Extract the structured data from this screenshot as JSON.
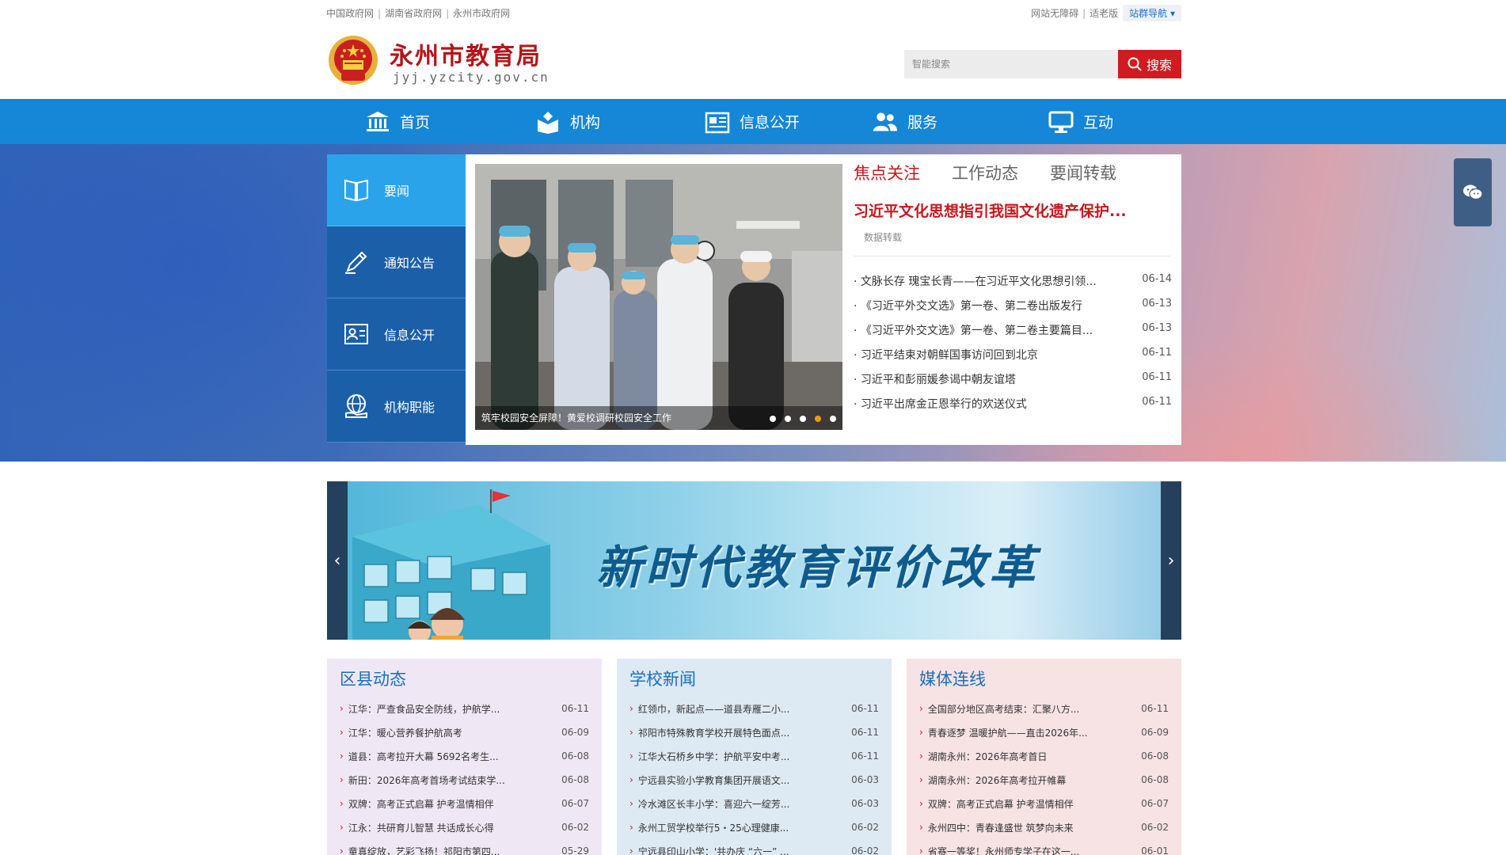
{
  "topbar": {
    "links": [
      "中国政府网",
      "湖南省政府网",
      "永州市政府网"
    ],
    "right_links": [
      "网站无障碍",
      "适老版"
    ],
    "sitemap": "站群导航 ▾"
  },
  "header": {
    "site_name": "永州市教育局",
    "site_url": "jyj.yzcity.gov.cn",
    "search_placeholder": "智能搜索",
    "search_button": "搜索"
  },
  "nav": [
    {
      "label": "首页",
      "icon": "home-icon"
    },
    {
      "label": "机构",
      "icon": "organization-icon"
    },
    {
      "label": "信息公开",
      "icon": "info-icon"
    },
    {
      "label": "服务",
      "icon": "people-icon"
    },
    {
      "label": "互动",
      "icon": "monitor-icon"
    }
  ],
  "side_menu": [
    {
      "label": "要闻",
      "icon": "book-icon"
    },
    {
      "label": "通知公告",
      "icon": "pen-icon"
    },
    {
      "label": "信息公开",
      "icon": "id-card-icon"
    },
    {
      "label": "机构职能",
      "icon": "globe-hand-icon"
    }
  ],
  "slide": {
    "caption": "筑牢校园安全屏障！黄爱校调研校园安全工作",
    "dot_count": 5,
    "active_dot": 3
  },
  "tabs": [
    "焦点关注",
    "工作动态",
    "要闻转载"
  ],
  "headline": {
    "title": "习近平文化思想指引我国文化遗产保护...",
    "source": "数据转载"
  },
  "news": [
    {
      "title": "· 文脉长存 瑰宝长青——在习近平文化思想引领...",
      "date": "06-14"
    },
    {
      "title": "· 《习近平外交文选》第一卷、第二卷出版发行",
      "date": "06-13"
    },
    {
      "title": "· 《习近平外交文选》第一卷、第二卷主要篇目...",
      "date": "06-13"
    },
    {
      "title": "· 习近平结束对朝鲜国事访问回到北京",
      "date": "06-11"
    },
    {
      "title": "· 习近平和彭丽媛参谒中朝友谊塔",
      "date": "06-11"
    },
    {
      "title": "· 习近平出席金正恩举行的欢送仪式",
      "date": "06-11"
    }
  ],
  "banner": {
    "title": "新时代教育评价改革",
    "prev": "‹",
    "next": "›"
  },
  "columns": [
    {
      "title": "区县动态",
      "bg": "#efe8f4",
      "items": [
        {
          "title": "江华：严查食品安全防线，护航学...",
          "date": "06-11"
        },
        {
          "title": "江华：暖心营养餐护航高考",
          "date": "06-09"
        },
        {
          "title": "道县：高考拉开大幕 5692名考生...",
          "date": "06-08"
        },
        {
          "title": "新田：2026年高考首场考试结束学...",
          "date": "06-08"
        },
        {
          "title": "双牌：高考正式启幕 护考温情相伴",
          "date": "06-07"
        },
        {
          "title": "江永：共研育儿智慧 共话成长心得",
          "date": "06-02"
        },
        {
          "title": "童真绽放，艺彩飞扬！祁阳市第四...",
          "date": "05-29"
        }
      ]
    },
    {
      "title": "学校新闻",
      "bg": "#dde9f3",
      "items": [
        {
          "title": "红领巾，新起点——道县寿雁二小...",
          "date": "06-11"
        },
        {
          "title": "祁阳市特殊教育学校开展特色面点...",
          "date": "06-11"
        },
        {
          "title": "江华大石桥乡中学：护航平安中考...",
          "date": "06-11"
        },
        {
          "title": "宁远县实验小学教育集团开展语文...",
          "date": "06-03"
        },
        {
          "title": "冷水滩区长丰小学：喜迎六一绽芳...",
          "date": "06-03"
        },
        {
          "title": "永州工贸学校举行5・25心理健康...",
          "date": "06-02"
        },
        {
          "title": "宁远县印山小学：'共办庆 “六一” ...",
          "date": "06-02"
        }
      ]
    },
    {
      "title": "媒体连线",
      "bg": "#f7e2e4",
      "items": [
        {
          "title": "全国部分地区高考结束：汇聚八方...",
          "date": "06-11"
        },
        {
          "title": "青春逐梦 温暖护航——直击2026年...",
          "date": "06-09"
        },
        {
          "title": "湖南永州：2026年高考首日",
          "date": "06-08"
        },
        {
          "title": "湖南永州：2026年高考拉开帷幕",
          "date": "06-08"
        },
        {
          "title": "双牌：高考正式启幕 护考温情相伴",
          "date": "06-07"
        },
        {
          "title": "永州四中：青春逢盛世 筑梦向未来",
          "date": "06-02"
        },
        {
          "title": "省赛一等奖！永州师专学子在这一...",
          "date": "06-01"
        }
      ]
    }
  ],
  "colors": {
    "brand_red": "#c8161d",
    "nav_blue": "#1686d6",
    "side_active": "#2aa3ea",
    "side_dark": "#1c5fa9"
  },
  "float_icon": "wechat-icon"
}
